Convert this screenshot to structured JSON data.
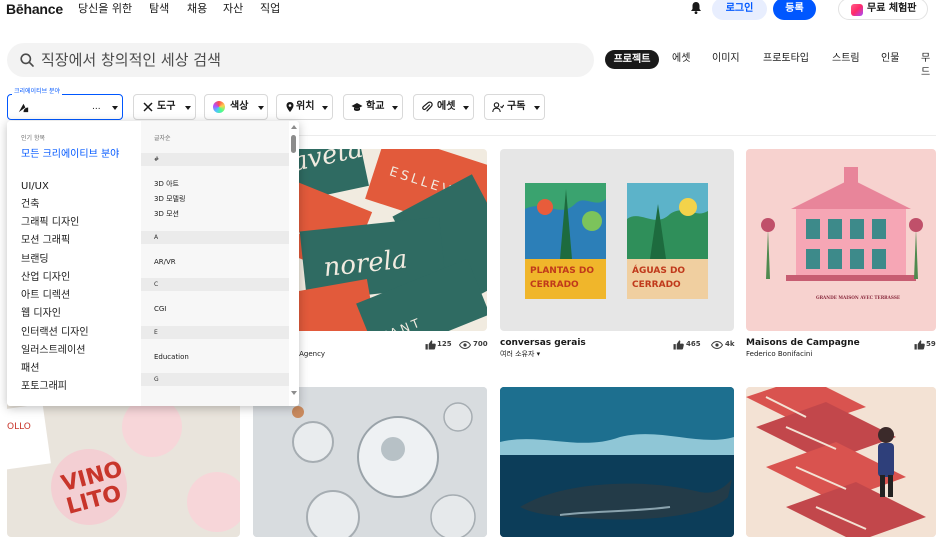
{
  "nav": {
    "logo": "Bēhance",
    "links": [
      "당신을 위한",
      "탐색",
      "채용",
      "자산",
      "직업"
    ],
    "login": "로그인",
    "signup": "등록",
    "trial": "무료 체험판"
  },
  "search": {
    "placeholder": "직장에서 창의적인 세상 검색"
  },
  "tabs": {
    "active": "프로젝트",
    "items": [
      "에셋",
      "이미지",
      "프로토타입",
      "스트림",
      "인물",
      "무드"
    ]
  },
  "filters": {
    "category_legend": "크리에이티브 분야",
    "category_value": "...",
    "chips": [
      "도구",
      "색상",
      "위치",
      "학교",
      "에셋",
      "구독"
    ]
  },
  "dropdown": {
    "popular_header": "인기 항목",
    "popular_items": [
      "모든 크리에이티브 분야",
      "UI/UX",
      "건축",
      "그래픽 디자인",
      "모션 그래픽",
      "브랜딩",
      "산업 디자인",
      "아트 디렉션",
      "웹 디자인",
      "인터랙션 디자인",
      "일러스트레이션",
      "패션",
      "포토그래피"
    ],
    "alpha_header": "글자순",
    "groups": [
      {
        "letter": "#",
        "items": [
          "3D 아트",
          "3D 모델링",
          "3D 모션"
        ]
      },
      {
        "letter": "A",
        "items": [
          "AR/VR"
        ]
      },
      {
        "letter": "C",
        "items": [
          "CGI"
        ]
      },
      {
        "letter": "E",
        "items": [
          "Education"
        ]
      },
      {
        "letter": "G",
        "items": []
      }
    ]
  },
  "cards": [
    {
      "title": "",
      "subtitle": "gn Agency",
      "likes": "125",
      "views": "700"
    },
    {
      "title": "conversas gerais",
      "subtitle": "여러 소유자",
      "likes": "465",
      "views": "4k"
    },
    {
      "title": "Maisons de Campagne",
      "subtitle": "Federico Bonifacini",
      "likes": "59",
      "views": ""
    }
  ],
  "artwork_text": {
    "card1": [
      "ESLLEV",
      "VANT",
      "norela",
      "aveta"
    ],
    "card2": [
      "PLANTAS DO CERRADO",
      "ÁGUAS DO CERRADO"
    ],
    "card3": [
      "GRANDE MAISON AVEC TERRASSE"
    ],
    "card4": [
      "OLLO",
      "VINO LITO"
    ]
  },
  "colors": {
    "accent": "#0057ff",
    "login_bg": "#e8eefe",
    "active_tab": "#191919"
  }
}
